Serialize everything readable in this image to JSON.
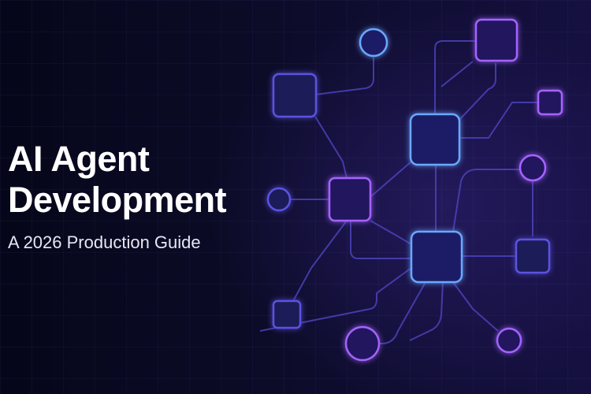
{
  "banner": {
    "title_line_1": "AI Agent",
    "title_line_2": "Development",
    "subtitle": "A 2026 Production Guide"
  },
  "colors": {
    "background": "#0a0a22",
    "accent_blue": "#6aa8ff",
    "accent_purple": "#a463ff",
    "accent_indigo": "#5b52e0",
    "text": "#ffffff"
  }
}
